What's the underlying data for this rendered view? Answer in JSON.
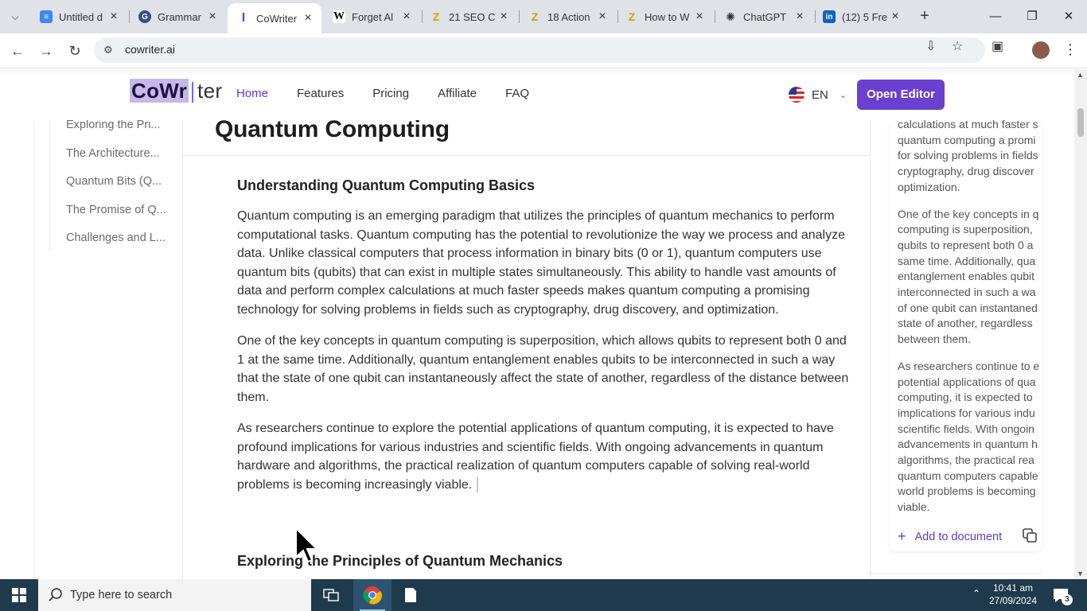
{
  "browser": {
    "tabs": [
      {
        "title": "Untitled d",
        "icon": "google-docs-icon",
        "color": "#4285f4"
      },
      {
        "title": "Grammar",
        "icon": "grammarly-icon",
        "color": "#15c39a"
      },
      {
        "title": "CoWriter",
        "icon": "cowriter-icon",
        "color": "#6b3fcf",
        "active": true
      },
      {
        "title": "Forget Al",
        "icon": "wikipedia-icon",
        "color": "#000000"
      },
      {
        "title": "21 SEO C",
        "icon": "z-icon",
        "color": "#e6b800"
      },
      {
        "title": "18 Action",
        "icon": "z-icon",
        "color": "#e6b800"
      },
      {
        "title": "How to W",
        "icon": "z-icon",
        "color": "#e6b800"
      },
      {
        "title": "ChatGPT",
        "icon": "chatgpt-icon",
        "color": "#333333"
      },
      {
        "title": "(12) 5 Fre",
        "icon": "linkedin-icon",
        "color": "#0a66c2"
      }
    ],
    "url": "cowriter.ai"
  },
  "site": {
    "logo_highlight": "CoWr",
    "logo_rest": "ter",
    "nav": [
      "Home",
      "Features",
      "Pricing",
      "Affiliate",
      "FAQ"
    ],
    "language": "EN",
    "open_editor": "Open Editor"
  },
  "toc": [
    "Exploring the Pri...",
    "The Architecture...",
    "Quantum Bits (Q...",
    "The Promise of Q...",
    "Challenges and L..."
  ],
  "article": {
    "title": "Quantum Computing",
    "section1_heading": "Understanding Quantum Computing Basics",
    "paragraphs": [
      "Quantum computing is an emerging paradigm that utilizes the principles of quantum mechanics to perform computational tasks. Quantum computing has the potential to revolutionize the way we process and analyze data. Unlike classical computers that process information in binary bits (0 or 1), quantum computers use quantum bits (qubits) that can exist in multiple states simultaneously. This ability to handle vast amounts of data and perform complex calculations at much faster speeds makes quantum computing a promising technology for solving problems in fields such as cryptography, drug discovery, and optimization.",
      "One of the key concepts in quantum computing is superposition, which allows qubits to represent both 0 and 1 at the same time. Additionally, quantum entanglement enables qubits to be interconnected in such a way that the state of one qubit can instantaneously affect the state of another, regardless of the distance between them.",
      "As researchers continue to explore the potential applications of quantum computing, it is expected to have profound implications for various industries and scientific fields. With ongoing advancements in quantum hardware and algorithms, the practical realization of quantum computers capable of solving real-world problems is becoming increasingly viable."
    ],
    "section2_heading": "Exploring the Principles of Quantum Mechanics"
  },
  "side_panel": {
    "lines_p1": [
      "calculations at much faster s",
      "quantum computing a promi",
      "for solving problems in fields",
      "cryptography, drug discover",
      "optimization."
    ],
    "lines_p2": [
      "One of the key concepts in q",
      "computing is superposition,",
      "qubits to represent both 0 a",
      "same time. Additionally, qua",
      "entanglement enables qubit",
      "interconnected in such a wa",
      "of one qubit can instantaned",
      "state of another, regardless",
      "between them."
    ],
    "lines_p3": [
      "As researchers continue to e",
      "potential applications of qua",
      "computing, it is expected to",
      "implications for various indu",
      "scientific fields. With ongoin",
      "advancements in quantum h",
      "algorithms, the practical rea",
      "quantum computers capable",
      "world problems is becoming",
      "viable."
    ],
    "add_to_document": "Add to document"
  },
  "taskbar": {
    "search_placeholder": "Type here to search",
    "time": "10:41 am",
    "date": "27/09/2024",
    "notifications": "3"
  }
}
